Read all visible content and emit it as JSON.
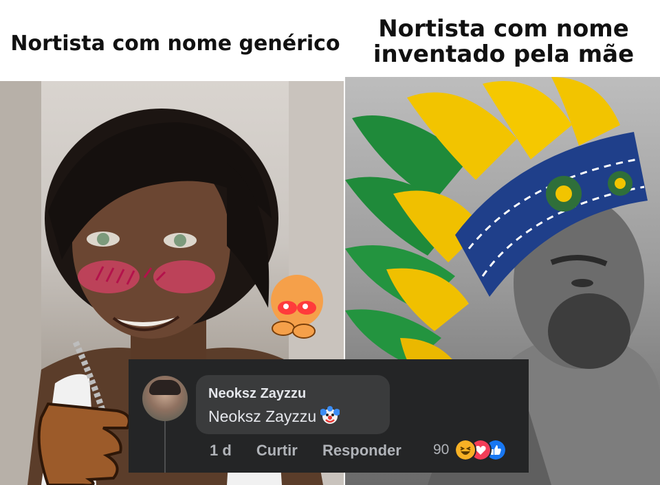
{
  "captions": {
    "left": "Nortista com nome genérico",
    "right_line1": "Nortista com nome",
    "right_line2": "inventado pela mãe"
  },
  "comment": {
    "author": "Neoksz Zayzzu",
    "text": "Neoksz Zayzzu",
    "text_emoji": "clown-face-icon",
    "time": "1 d",
    "like_label": "Curtir",
    "reply_label": "Responder",
    "reaction_count": "90",
    "reactions": [
      "haha-icon",
      "love-icon",
      "like-icon"
    ]
  },
  "colors": {
    "comment_bg": "#242526",
    "bubble_bg": "#3a3b3c",
    "text_primary": "#e4e6eb",
    "text_secondary": "#b0b3b8",
    "like_blue": "#1877f2",
    "love_red": "#f33e58",
    "haha_yellow": "#f7b125"
  }
}
